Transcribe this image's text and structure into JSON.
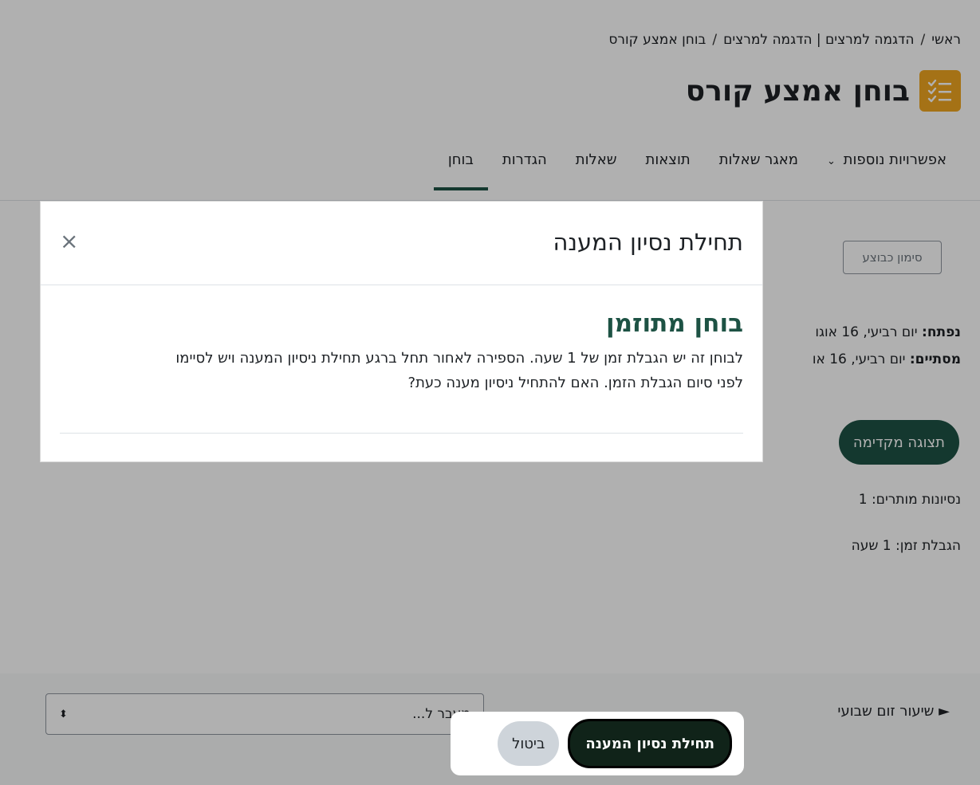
{
  "breadcrumb": {
    "items": [
      "ראשי",
      "הדגמה למרצים | הדגמה למרצים",
      "בוחן אמצע קורס"
    ]
  },
  "page": {
    "title": "בוחן אמצע קורס",
    "icon": "quiz-icon",
    "accent_color": "#f0a620"
  },
  "tabs": [
    {
      "label": "בוחן",
      "active": true
    },
    {
      "label": "הגדרות",
      "active": false
    },
    {
      "label": "שאלות",
      "active": false
    },
    {
      "label": "תוצאות",
      "active": false
    },
    {
      "label": "מאגר שאלות",
      "active": false
    },
    {
      "label": "אפשרויות נוספות",
      "active": false
    }
  ],
  "mark_done_label": "סימון כבוצע",
  "dates": {
    "opened_label": "נפתח:",
    "opened_value": "יום רביעי, 16 אוגו",
    "closes_label": "מסתיים:",
    "closes_value": "יום רביעי, 16 או"
  },
  "preview_label": "תצוגה מקדימה",
  "attempts_text": "נסיונות מותרים: 1",
  "time_limit_text": "הגבלת זמן: 1 שעה",
  "footer": {
    "jump_placeholder": "מעבר ל...",
    "next_activity": "שיעור זום שבועי"
  },
  "modal": {
    "title": "תחילת נסיון המענה",
    "close": "×",
    "heading": "בוחן מתוזמן",
    "body_line1": "לבוחן זה יש הגבלת זמן של 1 שעה. הספירה לאחור תחל ברגע תחילת ניסיון המענה ויש לסיימו",
    "body_line2": "לפני סיום הגבלת הזמן. האם להתחיל ניסיון מענה כעת?",
    "start_label": "תחילת נסיון המענה",
    "cancel_label": "ביטול"
  },
  "colors": {
    "primary": "#1d5244",
    "overlay": "rgba(0,0,0,0.31)"
  }
}
